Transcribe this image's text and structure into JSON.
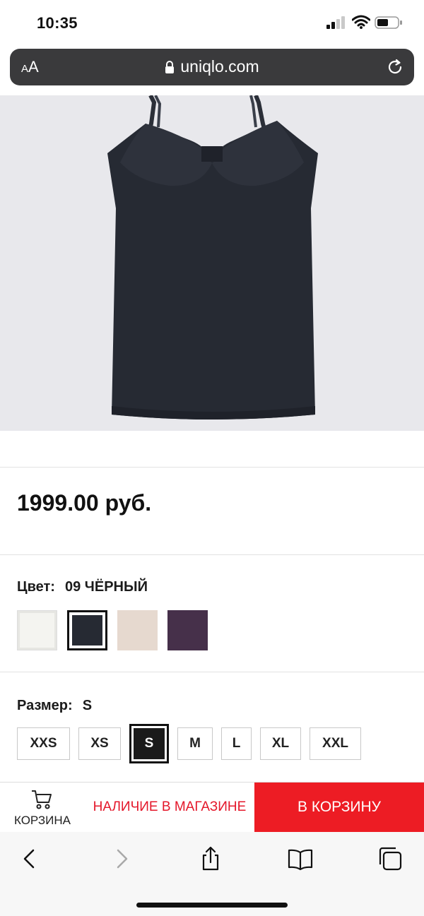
{
  "status_bar": {
    "time": "10:35",
    "icons": [
      "signal-icon",
      "wifi-icon",
      "battery-icon"
    ]
  },
  "browser": {
    "text_size_small": "A",
    "text_size_large": "A",
    "url": "uniqlo.com",
    "icons": [
      "lock-icon",
      "reload-icon"
    ]
  },
  "product": {
    "price": "1999.00 руб.",
    "color": {
      "label": "Цвет:",
      "value": "09 ЧЁРНЫЙ",
      "swatches": [
        {
          "name": "white",
          "hex": "#f4f4f0",
          "selected": false
        },
        {
          "name": "black",
          "hex": "#262a33",
          "selected": true
        },
        {
          "name": "beige",
          "hex": "#e6d9cf",
          "selected": false
        },
        {
          "name": "purple",
          "hex": "#46304a",
          "selected": false
        }
      ]
    },
    "size": {
      "label": "Размер:",
      "value": "S",
      "options": [
        {
          "label": "XXS",
          "selected": false
        },
        {
          "label": "XS",
          "selected": false
        },
        {
          "label": "S",
          "selected": true
        },
        {
          "label": "M",
          "selected": false
        },
        {
          "label": "L",
          "selected": false
        },
        {
          "label": "XL",
          "selected": false
        },
        {
          "label": "XXL",
          "selected": false
        }
      ]
    }
  },
  "actions": {
    "cart_label": "КОРЗИНА",
    "store_label": "НАЛИЧИЕ В МАГАЗИНЕ",
    "add_to_cart_label": "В КОРЗИНУ"
  },
  "toolbar": {
    "icons": [
      "back-icon",
      "forward-icon",
      "share-icon",
      "bookmarks-icon",
      "tabs-icon"
    ]
  },
  "colors": {
    "accent_red": "#ed1c24",
    "store_text_red": "#e4172a",
    "url_bar_bg": "#3a3a3c",
    "image_bg": "#e8e8ec"
  }
}
